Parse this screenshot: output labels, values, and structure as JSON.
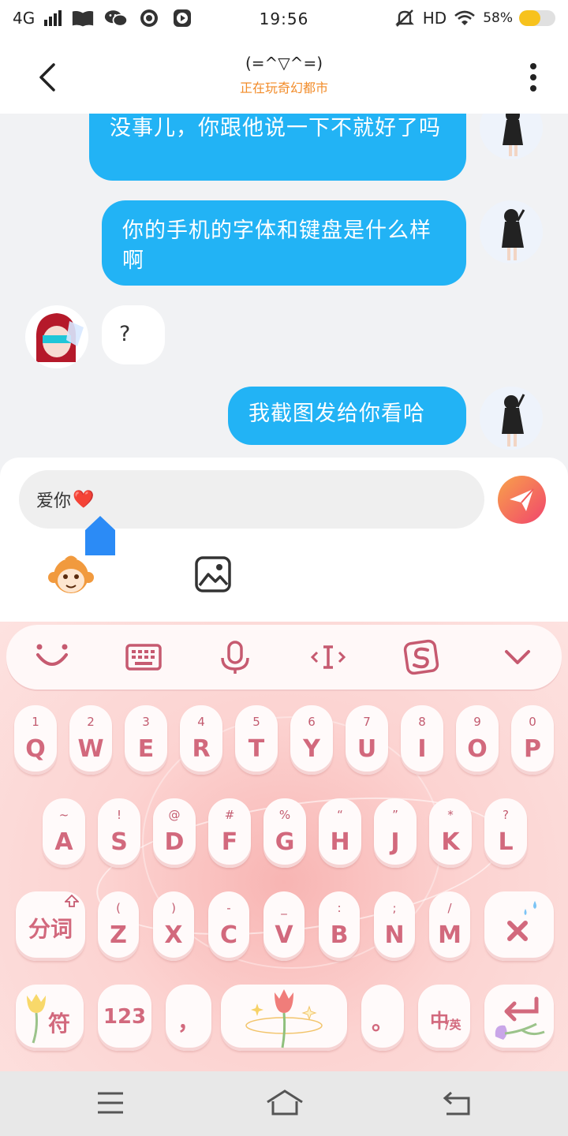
{
  "status_bar": {
    "network": "4G",
    "time": "19:56",
    "hd": "HD",
    "battery_percent": "58%",
    "battery_level": 0.58,
    "icons": [
      "signal-icon",
      "book-icon",
      "wechat-icon",
      "media-icon",
      "media-icon",
      "mute-icon",
      "wifi-icon",
      "battery-icon"
    ]
  },
  "header": {
    "title": "(=^▽^=)",
    "subtitle": "正在玩奇幻都市"
  },
  "messages": [
    {
      "side": "right",
      "text": "没事儿，你跟他说一下不就好了吗"
    },
    {
      "side": "right",
      "text": "你的手机的字体和键盘是什么样啊"
    },
    {
      "side": "left",
      "text": "?"
    },
    {
      "side": "right",
      "text": "我截图发给你看哈"
    }
  ],
  "input": {
    "value": "爱你",
    "emoji": "❤️"
  },
  "keyboard": {
    "toolbar": [
      "emoji-face-icon",
      "keyboard-icon",
      "microphone-icon",
      "cursor-icon",
      "sogou-icon",
      "collapse-icon"
    ],
    "row1": [
      {
        "hint": "1",
        "label": "Q"
      },
      {
        "hint": "2",
        "label": "W"
      },
      {
        "hint": "3",
        "label": "E"
      },
      {
        "hint": "4",
        "label": "R"
      },
      {
        "hint": "5",
        "label": "T"
      },
      {
        "hint": "6",
        "label": "Y"
      },
      {
        "hint": "7",
        "label": "U"
      },
      {
        "hint": "8",
        "label": "I"
      },
      {
        "hint": "9",
        "label": "O"
      },
      {
        "hint": "0",
        "label": "P"
      }
    ],
    "row2": [
      {
        "hint": "~",
        "label": "A"
      },
      {
        "hint": "!",
        "label": "S"
      },
      {
        "hint": "@",
        "label": "D"
      },
      {
        "hint": "#",
        "label": "F"
      },
      {
        "hint": "%",
        "label": "G"
      },
      {
        "hint": "“",
        "label": "H"
      },
      {
        "hint": "”",
        "label": "J"
      },
      {
        "hint": "*",
        "label": "K"
      },
      {
        "hint": "?",
        "label": "L"
      }
    ],
    "row3": [
      {
        "hint": "(",
        "label": "Z"
      },
      {
        "hint": ")",
        "label": "X"
      },
      {
        "hint": "-",
        "label": "C"
      },
      {
        "hint": "_",
        "label": "V"
      },
      {
        "hint": ":",
        "label": "B"
      },
      {
        "hint": ";",
        "label": "N"
      },
      {
        "hint": "/",
        "label": "M"
      }
    ],
    "fenci": "分词",
    "fu": "符",
    "num": "123",
    "comma": "，",
    "period": "。",
    "lang_main": "中",
    "lang_sub": "/英"
  }
}
